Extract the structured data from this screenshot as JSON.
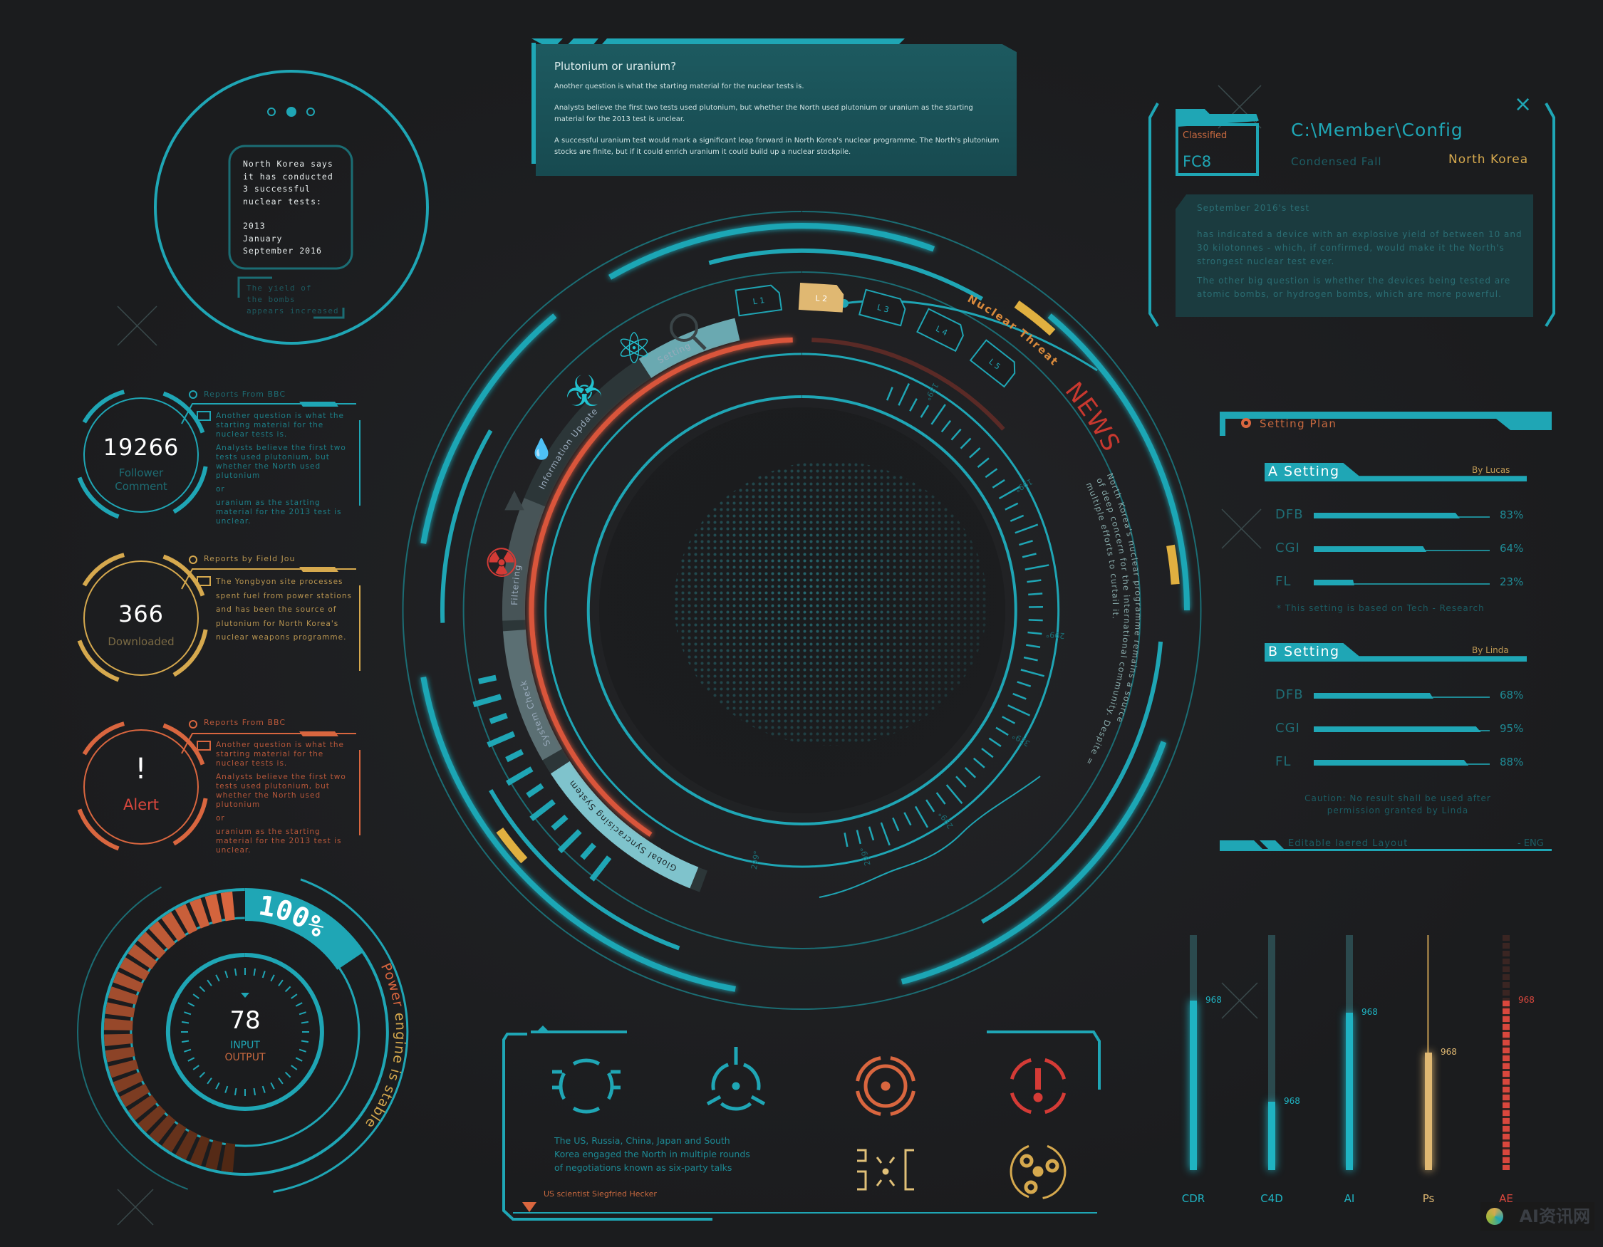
{
  "intro_circle": {
    "lines": [
      "North Korea says",
      "it has conducted",
      "3 successful",
      "nuclear tests:",
      "",
      "2013",
      "January",
      "September 2016"
    ],
    "caption": [
      "The yield of",
      "the bombs",
      "appears increased"
    ]
  },
  "news_panel": {
    "title": "Plutonium or uranium?",
    "paragraphs": [
      "Another question is what the starting material for the nuclear tests is.",
      "Analysts believe the first two tests used plutonium, but whether the North used plutonium or uranium as the starting material for the 2013 test is unclear.",
      "A successful uranium test would mark a significant leap forward in North Korea's nuclear programme. The North's plutonium stocks are finite, but if it could enrich uranium it could build up a nuclear stockpile."
    ]
  },
  "config_panel": {
    "folder_label": "Classified",
    "folder_code": "FC8",
    "path": "C:\\Member\\Config",
    "subtitle": "Condensed Fall",
    "country": "North Korea",
    "body_title": "September 2016's test",
    "body_p1": "has indicated a device with an explosive yield of between 10 and 30 kilotonnes - which, if confirmed, would make it the North's strongest nuclear test ever.",
    "body_p2": "The other big question is whether the devices being tested are atomic bombs, or hydrogen bombs, which are more powerful.",
    "close_icon": "×"
  },
  "stats": [
    {
      "value": "19266",
      "label1": "Follower",
      "label2": "Comment",
      "color": "#1fa6b5",
      "report_title": "Reports From BBC",
      "text": [
        "Another question is what the starting material for the nuclear tests is.",
        "Analysts believe the first two tests used plutonium, but whether the North used plutonium",
        "or",
        "uranium as the starting material for the 2013 test is unclear."
      ]
    },
    {
      "value": "366",
      "label1": "Downloaded",
      "label2": "",
      "color": "#d6a94e",
      "report_title": "Reports by Field Jou",
      "text": [
        "The Yongbyon site processes",
        "spent fuel from power stations",
        "and has been the source of",
        "plutonium for North Korea's",
        "nuclear weapons programme."
      ]
    },
    {
      "value": "!",
      "label1": "Alert",
      "label2": "",
      "color": "#d9663f",
      "report_title": "Reports From BBC",
      "text": [
        "Another question is what the starting material for the nuclear tests is.",
        "Analysts believe the first two tests used plutonium, but whether the North used plutonium",
        "or",
        "uranium as the starting material for the 2013 test is unclear."
      ]
    }
  ],
  "globe": {
    "band_labels": [
      "Global Syncracising System",
      "System Check",
      "Filtering",
      "Information Update",
      "Setting"
    ],
    "tabs": [
      "L 1",
      "L 2",
      "L 3",
      "L 4",
      "L 5"
    ],
    "active_tab": "L 2",
    "threat_label": "Nuclear Threat",
    "news_label": "NEWS",
    "news_text": [
      "North Korea's nuclear programme remains a source",
      "of deep concern for the international community. Despite =",
      "multiple efforts to curtail it."
    ],
    "tick_labels": [
      "189°",
      "199°",
      "299°",
      "329°",
      "299°",
      "299°",
      "299°"
    ]
  },
  "gauge": {
    "percent": "100%",
    "value": "78",
    "input_label": "INPUT",
    "output_label": "OUTPUT",
    "power_word": "Power",
    "power_rest": " engine is stable"
  },
  "icons_panel": {
    "text": [
      "The US, Russia, China, Japan and South",
      "Korea engaged the North in multiple rounds",
      "of negotiations known as six-party talks"
    ],
    "credit": "US scientist Siegfried Hecker",
    "icons": [
      "bracket-circle-icon",
      "tri-blade-icon",
      "target-gear-icon",
      "alert-circle-icon",
      "scatter-bracket-icon",
      "orbit-icon"
    ]
  },
  "setting_plan": {
    "title": "Setting Plan",
    "groups": [
      {
        "name": "A Setting",
        "author": "By Lucas",
        "rows": [
          {
            "label": "DFB",
            "pct": 83
          },
          {
            "label": "CGI",
            "pct": 64
          },
          {
            "label": "FL",
            "pct": 23
          }
        ],
        "note": "*   This setting is based on Tech - Research"
      },
      {
        "name": "B Setting",
        "author": "By Linda",
        "rows": [
          {
            "label": "DFB",
            "pct": 68
          },
          {
            "label": "CGI",
            "pct": 95
          },
          {
            "label": "FL",
            "pct": 88
          }
        ],
        "note": "Caution: No result shall be used after permission granted by Linda"
      }
    ],
    "footer_left": "Editable laered Layout",
    "footer_right": "- ENG"
  },
  "meters": [
    {
      "label": "CDR",
      "value": "968",
      "level": 72,
      "color": "#1fb3c2"
    },
    {
      "label": "C4D",
      "value": "968",
      "level": 29,
      "color": "#1fb3c2"
    },
    {
      "label": "AI",
      "value": "968",
      "level": 67,
      "color": "#1fb3c2"
    },
    {
      "label": "Ps",
      "value": "968",
      "level": 50,
      "color": "#e0b872"
    },
    {
      "label": "AE",
      "value": "968",
      "level": 72,
      "color": "#d9473d"
    }
  ],
  "watermark": "AI资讯网",
  "colors": {
    "teal": "#1fa6b5",
    "orange": "#d9663f",
    "gold": "#d6a94e",
    "red": "#d43b36",
    "background": "#1c1d1f"
  }
}
